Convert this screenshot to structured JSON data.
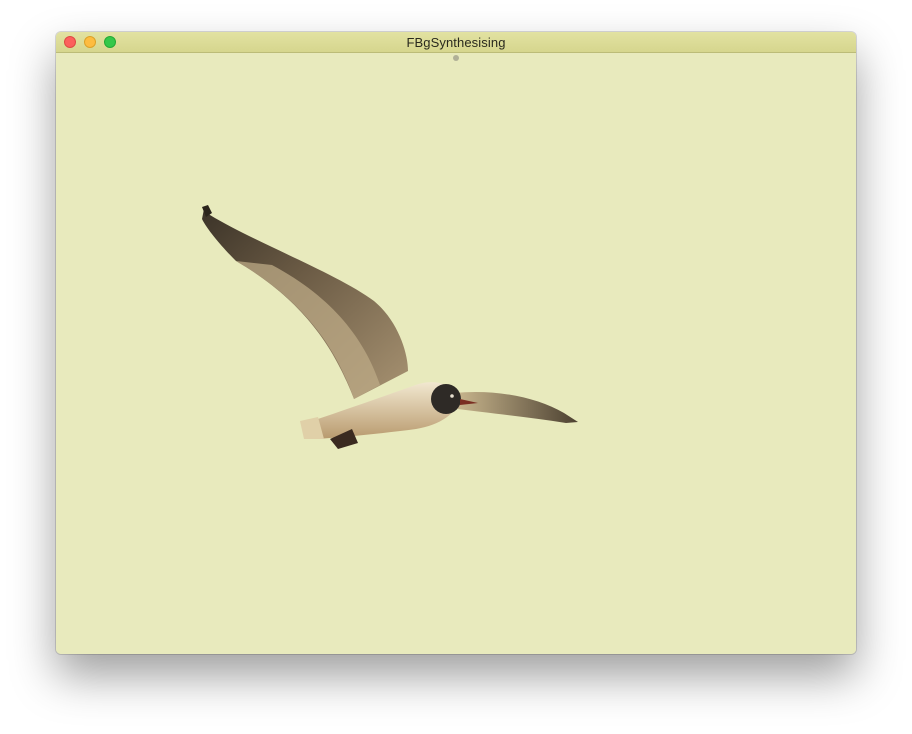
{
  "window": {
    "title": "FBgSynthesising",
    "background_color": "#e8eabd",
    "titlebar_color": "#d9d994"
  },
  "titlebar": {
    "close_icon": "close-icon",
    "minimize_icon": "minimize-icon",
    "zoom_icon": "zoom-icon",
    "close_color": "#fc605c",
    "minimize_color": "#fdbc40",
    "zoom_color": "#34c84a"
  },
  "content": {
    "image_icon": "seagull-image"
  }
}
